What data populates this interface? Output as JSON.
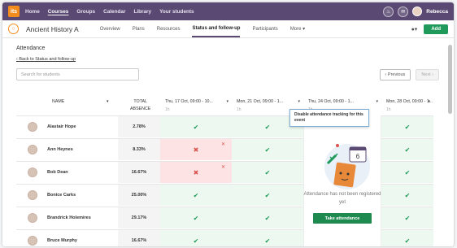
{
  "topnav": {
    "logo": "its",
    "items": [
      "Home",
      "Courses",
      "Groups",
      "Calendar",
      "Library",
      "Your students"
    ],
    "active_index": 1,
    "user_name": "Rebecca"
  },
  "course": {
    "title": "Ancient History A",
    "tabs": [
      "Overview",
      "Plans",
      "Resources",
      "Status and follow-up",
      "Participants",
      "More ▾"
    ],
    "active_tab": 3,
    "add_label": "Add"
  },
  "page": {
    "heading": "Attendance",
    "back_link": "Back to Status and follow-up",
    "search_placeholder": "Search for students",
    "previous_label": "Previous",
    "next_label": "Next"
  },
  "table": {
    "name_header": "NAME",
    "absence_header_line1": "TOTAL",
    "absence_header_line2": "ABSENCE",
    "events": [
      {
        "label": "Thu, 17 Oct, 09:00 - 10...",
        "duration": "1h"
      },
      {
        "label": "Mon, 21 Oct, 09:00 - 1...",
        "duration": "1h"
      },
      {
        "label": "Thu, 24 Oct, 09:00 - 1...",
        "duration": "1h"
      },
      {
        "label": "Mon, 28 Oct, 09:00 - 1...",
        "duration": "1h"
      }
    ],
    "rows": [
      {
        "name": "Alastair Hope",
        "absence": "2.78%",
        "e1": "present",
        "e2": "present",
        "e4": "present"
      },
      {
        "name": "Ann Heynes",
        "absence": "8.33%",
        "e1": "absent",
        "e2": "present",
        "e4": "present"
      },
      {
        "name": "Bob Dean",
        "absence": "16.67%",
        "e1": "absent",
        "e2": "present",
        "e4": "present"
      },
      {
        "name": "Bonice Carks",
        "absence": "25.00%",
        "e1": "present",
        "e2": "present",
        "e4": "present"
      },
      {
        "name": "Brandrick Holemires",
        "absence": "29.17%",
        "e1": "present",
        "e2": "present",
        "e4": "present"
      },
      {
        "name": "Bruce Murphy",
        "absence": "16.67%",
        "e1": "present",
        "e2": "present",
        "e4": "present"
      }
    ]
  },
  "empty_event": {
    "tooltip": "Disable attendance tracking for this event",
    "calendar_number": "6",
    "message": "Attendance has not been registered yet",
    "button": "Take attendance"
  }
}
